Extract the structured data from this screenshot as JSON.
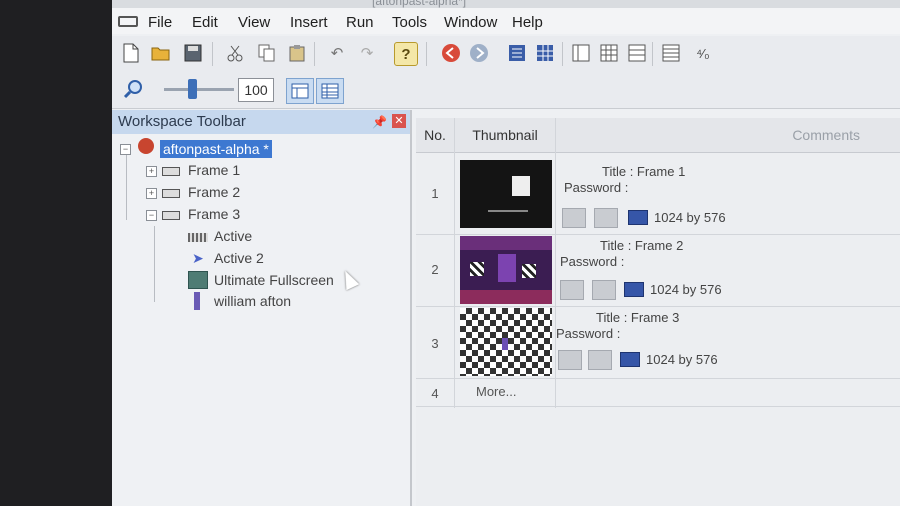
{
  "window": {
    "title": "[aftonpast-alpha*]"
  },
  "menu": {
    "items": [
      "File",
      "Edit",
      "View",
      "Insert",
      "Run",
      "Tools",
      "Window",
      "Help"
    ]
  },
  "toolbar": {
    "zoom_value": "100"
  },
  "workspace": {
    "title": "Workspace Toolbar",
    "root": "aftonpast-alpha *",
    "frames": [
      "Frame 1",
      "Frame 2",
      "Frame 3"
    ],
    "frame3_children": [
      "Active",
      "Active 2",
      "Ultimate Fullscreen",
      "william afton"
    ]
  },
  "grid": {
    "headers": {
      "no": "No.",
      "thumbnail": "Thumbnail",
      "comments": "Comments"
    },
    "rows": [
      {
        "no": "1",
        "title": "Title : Frame 1",
        "password": "Password :",
        "resolution": "1024 by 576"
      },
      {
        "no": "2",
        "title": "Title : Frame 2",
        "password": "Password :",
        "resolution": "1024 by 576"
      },
      {
        "no": "3",
        "title": "Title : Frame 3",
        "password": "Password :",
        "resolution": "1024 by 576"
      }
    ],
    "more": {
      "no": "4",
      "label": "More..."
    }
  },
  "colors": {
    "accent": "#3d78d1",
    "panel_header": "#c6d8ee",
    "close": "#d9534f"
  }
}
